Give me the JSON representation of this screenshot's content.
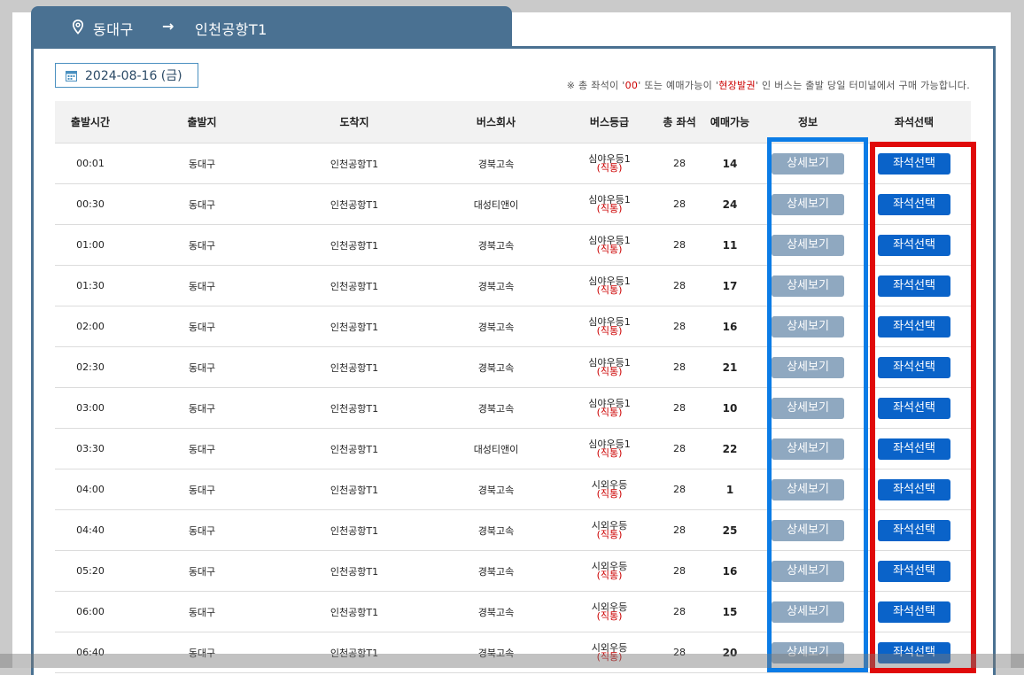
{
  "route": {
    "from": "동대구",
    "arrow": "→",
    "to": "인천공항T1"
  },
  "date": "2024-08-16 (금)",
  "notice": {
    "prefix": "※ 총 좌석이 '",
    "zero": "00",
    "mid": "' 또는 예매가능이 '",
    "onsite": "현장발권",
    "suffix": "' 인 버스는 출발 당일 터미널에서 구매 가능합니다."
  },
  "headers": [
    "출발시간",
    "출발지",
    "도착지",
    "버스회사",
    "버스등급",
    "총 좌석",
    "예매가능",
    "정보",
    "좌석선택"
  ],
  "detail_label": "상세보기",
  "seat_label": "좌석선택",
  "rows": [
    {
      "time": "00:01",
      "origin": "동대구",
      "dest": "인천공항T1",
      "company": "경북고속",
      "grade": "심야우등1",
      "direct": "(직통)",
      "total": "28",
      "available": "14"
    },
    {
      "time": "00:30",
      "origin": "동대구",
      "dest": "인천공항T1",
      "company": "대성티앤이",
      "grade": "심야우등1",
      "direct": "(직통)",
      "total": "28",
      "available": "24"
    },
    {
      "time": "01:00",
      "origin": "동대구",
      "dest": "인천공항T1",
      "company": "경북고속",
      "grade": "심야우등1",
      "direct": "(직통)",
      "total": "28",
      "available": "11"
    },
    {
      "time": "01:30",
      "origin": "동대구",
      "dest": "인천공항T1",
      "company": "경북고속",
      "grade": "심야우등1",
      "direct": "(직통)",
      "total": "28",
      "available": "17"
    },
    {
      "time": "02:00",
      "origin": "동대구",
      "dest": "인천공항T1",
      "company": "경북고속",
      "grade": "심야우등1",
      "direct": "(직통)",
      "total": "28",
      "available": "16"
    },
    {
      "time": "02:30",
      "origin": "동대구",
      "dest": "인천공항T1",
      "company": "경북고속",
      "grade": "심야우등1",
      "direct": "(직통)",
      "total": "28",
      "available": "21"
    },
    {
      "time": "03:00",
      "origin": "동대구",
      "dest": "인천공항T1",
      "company": "경북고속",
      "grade": "심야우등1",
      "direct": "(직통)",
      "total": "28",
      "available": "10"
    },
    {
      "time": "03:30",
      "origin": "동대구",
      "dest": "인천공항T1",
      "company": "대성티앤이",
      "grade": "심야우등1",
      "direct": "(직통)",
      "total": "28",
      "available": "22"
    },
    {
      "time": "04:00",
      "origin": "동대구",
      "dest": "인천공항T1",
      "company": "경북고속",
      "grade": "시외우등",
      "direct": "(직통)",
      "total": "28",
      "available": "1"
    },
    {
      "time": "04:40",
      "origin": "동대구",
      "dest": "인천공항T1",
      "company": "경북고속",
      "grade": "시외우등",
      "direct": "(직통)",
      "total": "28",
      "available": "25"
    },
    {
      "time": "05:20",
      "origin": "동대구",
      "dest": "인천공항T1",
      "company": "경북고속",
      "grade": "시외우등",
      "direct": "(직통)",
      "total": "28",
      "available": "16"
    },
    {
      "time": "06:00",
      "origin": "동대구",
      "dest": "인천공항T1",
      "company": "경북고속",
      "grade": "시외우등",
      "direct": "(직통)",
      "total": "28",
      "available": "15"
    },
    {
      "time": "06:40",
      "origin": "동대구",
      "dest": "인천공항T1",
      "company": "경북고속",
      "grade": "시외우등",
      "direct": "(직통)",
      "total": "28",
      "available": "20"
    }
  ],
  "colors": {
    "header_tab": "#4a7192",
    "seat_button": "#0a63c9",
    "detail_button": "#8fa8c0",
    "highlight_blue": "#0b7ce6",
    "highlight_red": "#e00a0a"
  }
}
